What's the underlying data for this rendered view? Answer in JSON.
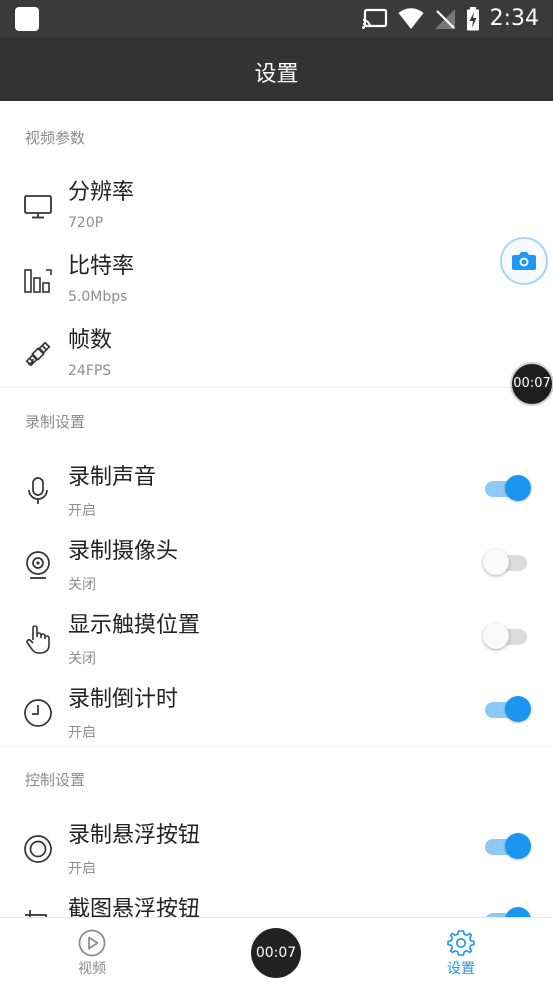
{
  "status_bar": {
    "time": "2:34"
  },
  "app_bar": {
    "title": "设置"
  },
  "sections": [
    {
      "header": "视频参数",
      "items": [
        {
          "title": "分辨率",
          "subtitle": "720P",
          "icon": "monitor-icon"
        },
        {
          "title": "比特率",
          "subtitle": "5.0Mbps",
          "icon": "bitrate-bars-icon"
        },
        {
          "title": "帧数",
          "subtitle": "24FPS",
          "icon": "satellite-icon"
        }
      ]
    },
    {
      "header": "录制设置",
      "items": [
        {
          "title": "录制声音",
          "subtitle": "开启",
          "icon": "microphone-icon",
          "toggle": true
        },
        {
          "title": "录制摄像头",
          "subtitle": "关闭",
          "icon": "webcam-icon",
          "toggle": false
        },
        {
          "title": "显示触摸位置",
          "subtitle": "关闭",
          "icon": "touch-hand-icon",
          "toggle": false
        },
        {
          "title": "录制倒计时",
          "subtitle": "开启",
          "icon": "clock-icon",
          "toggle": true
        }
      ]
    },
    {
      "header": "控制设置",
      "items": [
        {
          "title": "录制悬浮按钮",
          "subtitle": "开启",
          "icon": "record-circle-icon",
          "toggle": true
        },
        {
          "title": "截图悬浮按钮",
          "subtitle": "",
          "icon": "crop-icon",
          "toggle": true
        }
      ]
    }
  ],
  "floating": {
    "timer": "00:07",
    "camera_icon": "camera-icon"
  },
  "bottom_nav": {
    "video_label": "视频",
    "settings_label": "设置",
    "center_timer": "00:07",
    "active_color": "#1a96f0",
    "inactive_color": "#8a8a8a"
  }
}
